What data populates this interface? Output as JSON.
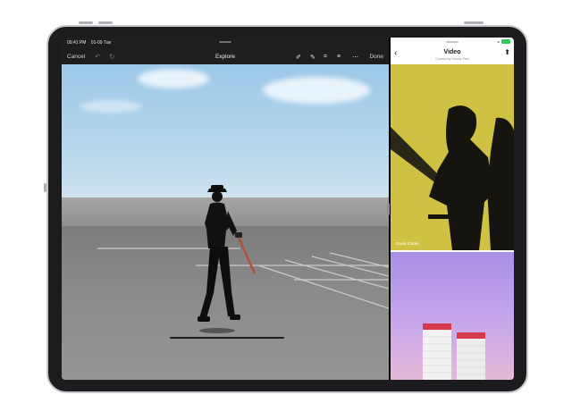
{
  "status_bar": {
    "time": "09:41 PM",
    "date": "01-09 Tue"
  },
  "editor": {
    "cancel_label": "Cancel",
    "title": "Explore",
    "done_label": "Done",
    "icons": [
      "undo-icon",
      "redo-icon",
      "markup-pen-icon",
      "retouch-icon",
      "crop-icon",
      "adjust-icon",
      "more-icon"
    ]
  },
  "side_panel": {
    "title": "Video",
    "subtitle": "Curated by Nicolas Paul",
    "tiles": [
      {
        "caption": "David Clarke"
      },
      {
        "caption": ""
      }
    ]
  },
  "colors": {
    "accent_battery": "#34c759",
    "tile1_bg": "#cfc142"
  }
}
